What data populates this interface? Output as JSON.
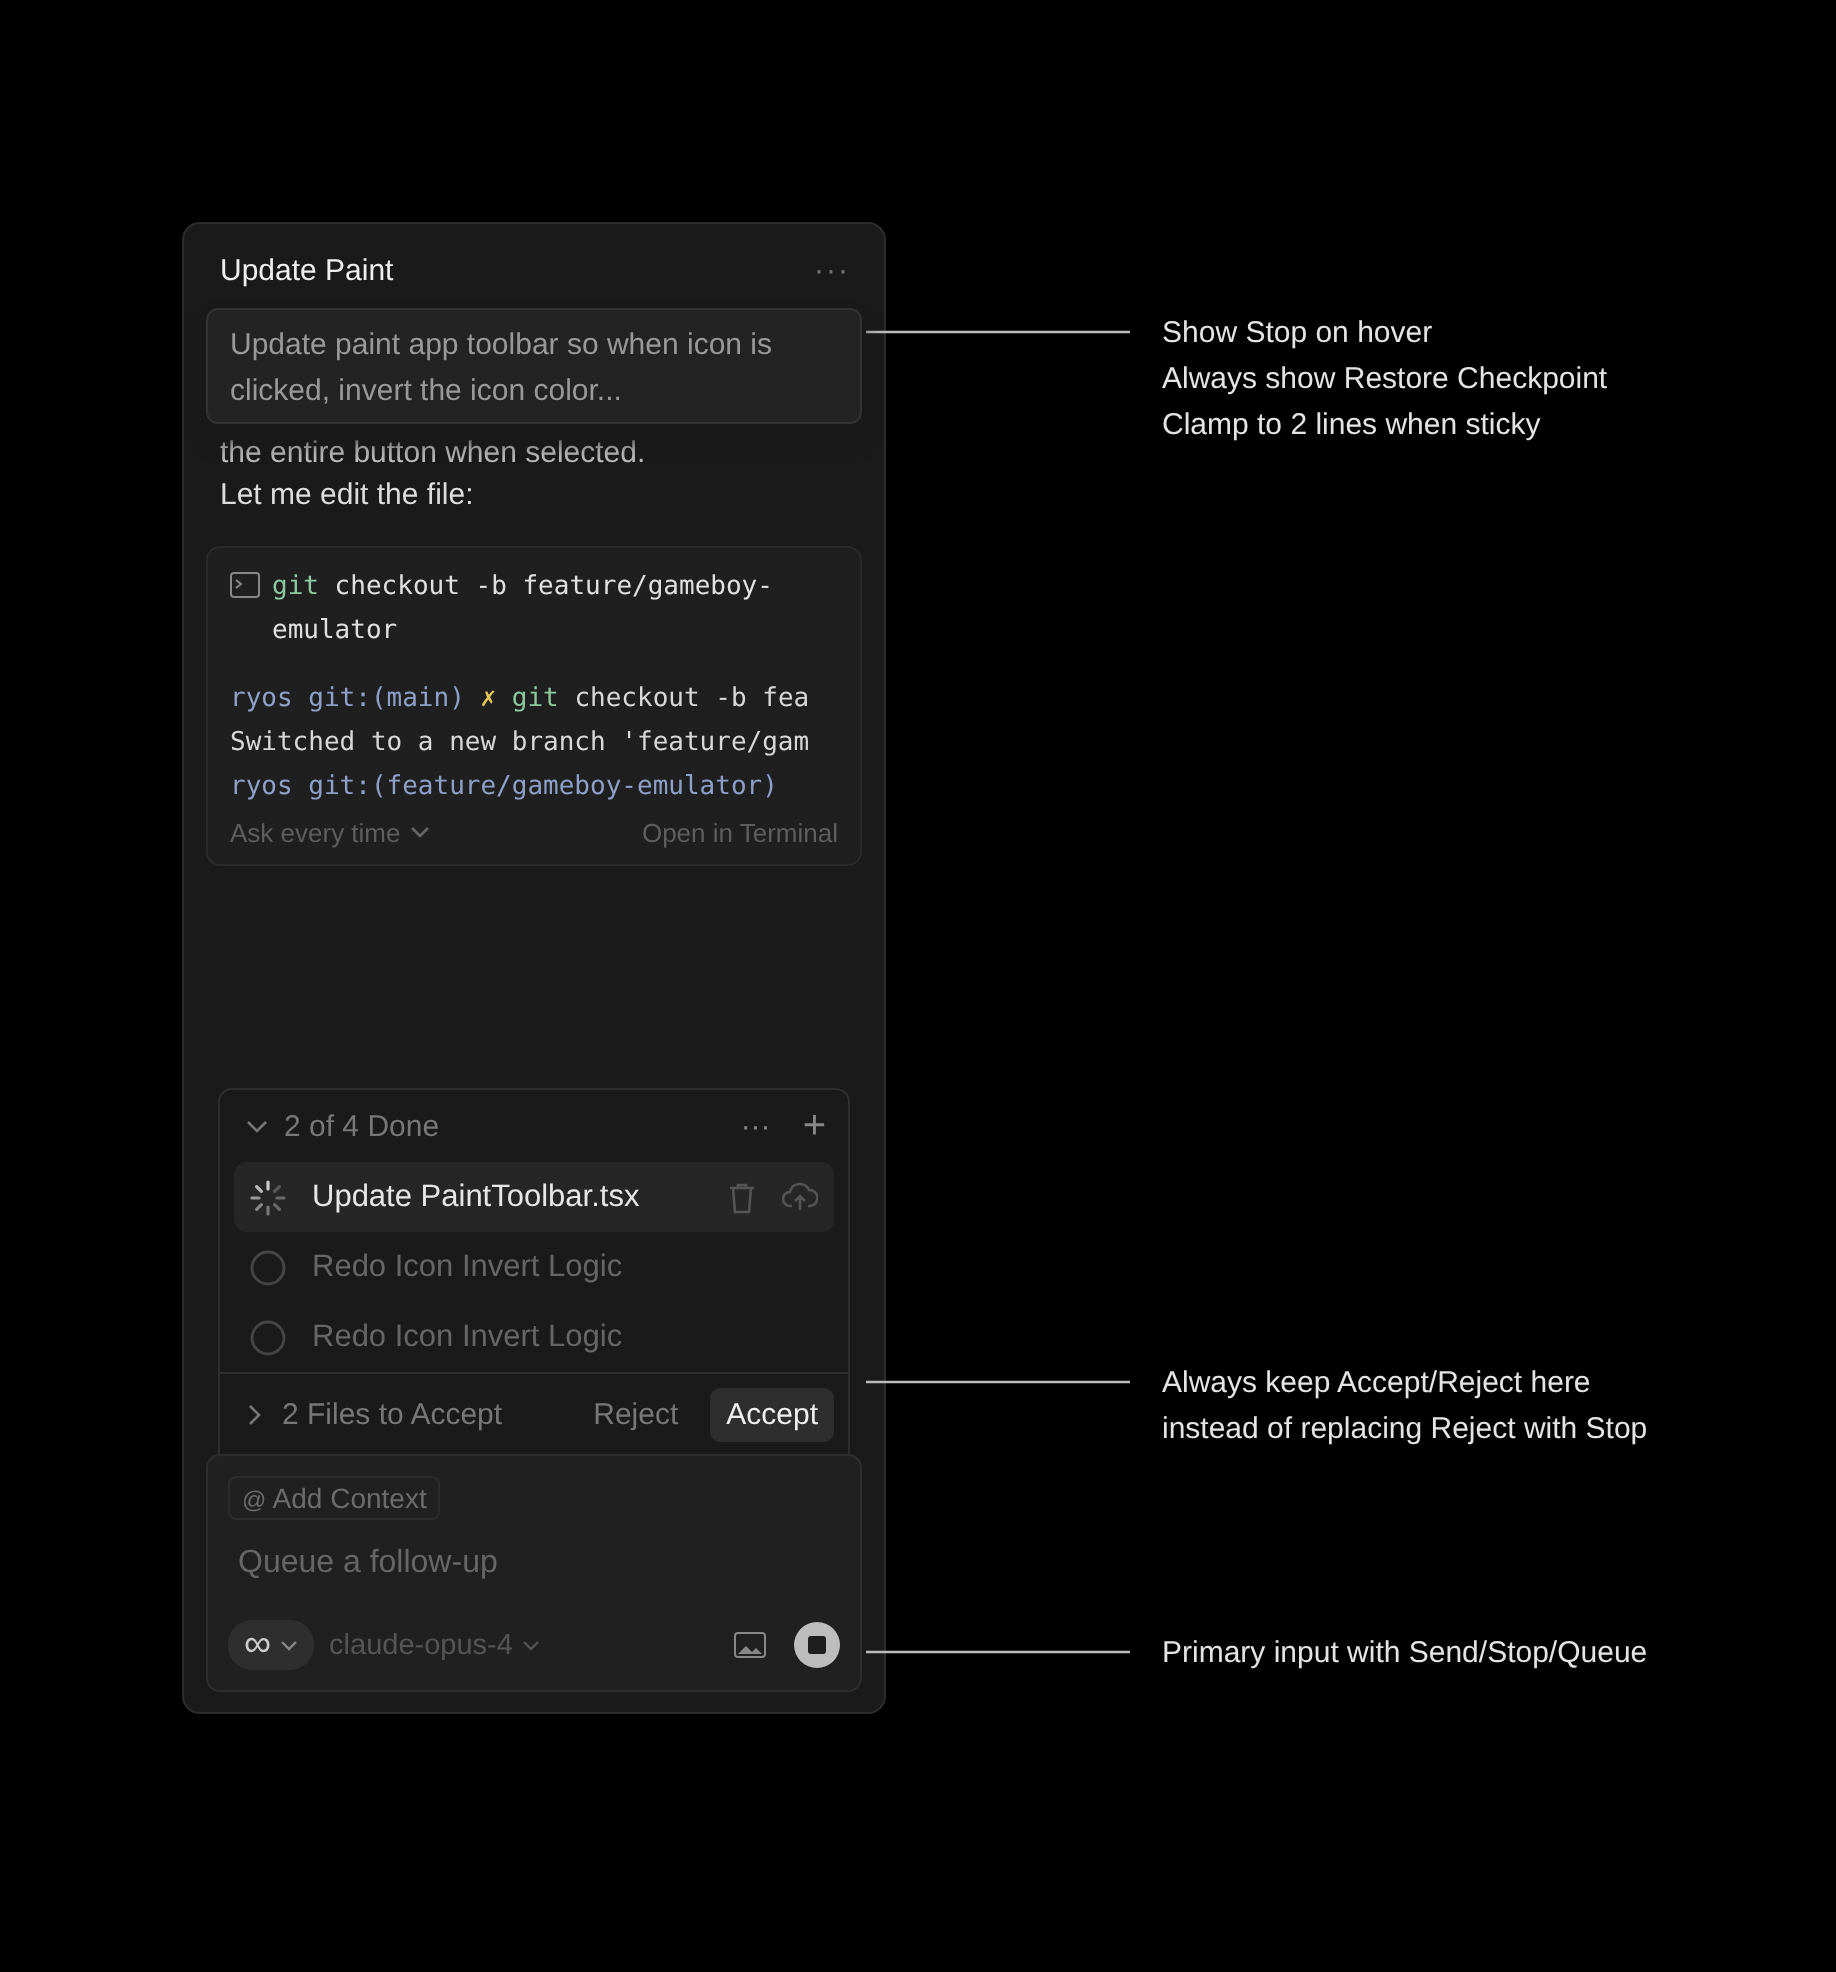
{
  "panel": {
    "title": "Update Paint",
    "menu": "···"
  },
  "sticky_prompt": "Update paint app toolbar so when icon is clicked, invert the icon color...",
  "message": {
    "hidden_line": "the entire button when selected.",
    "line": "Let me edit the file:"
  },
  "terminal": {
    "command_keyword": "git",
    "command": "checkout -b feature/gameboy-emulator",
    "lines": [
      [
        {
          "kind": "prompt",
          "text": "ryos git:(main) "
        },
        {
          "kind": "cross",
          "text": "✗ "
        },
        {
          "kind": "cmd",
          "text": "git "
        },
        {
          "kind": "plain",
          "text": "checkout -b fea"
        }
      ],
      [
        {
          "kind": "plain",
          "text": "Switched to a new branch 'feature/gam"
        }
      ],
      [
        {
          "kind": "prompt",
          "text": "ryos git:(feature/gameboy-emulator)"
        }
      ]
    ],
    "ask": "Ask every time",
    "open": "Open in Terminal"
  },
  "todos": {
    "summary": "2 of 4 Done",
    "expanded": true,
    "more": "···",
    "add": "+",
    "items": [
      {
        "label": "Update PaintToolbar.tsx",
        "kind": "running",
        "selected": true
      },
      {
        "label": "Redo Icon Invert Logic",
        "kind": "pending",
        "selected": false
      },
      {
        "label": "Redo Icon Invert Logic",
        "kind": "pending",
        "selected": false
      }
    ]
  },
  "review": {
    "files": "2 Files to Accept",
    "reject": "Reject",
    "accept": "Accept"
  },
  "composer": {
    "context_at": "@",
    "context": "Add Context",
    "placeholder": "Queue a follow-up",
    "mode": "∞",
    "model": "claude-opus-4"
  },
  "annotations": [
    {
      "lines": [
        "Show Stop on hover",
        "Always show Restore Checkpoint",
        "Clamp to 2 lines when sticky"
      ]
    },
    {
      "lines": [
        "Always keep Accept/Reject here",
        "instead of replacing Reject with Stop"
      ]
    },
    {
      "lines": [
        "Primary input with Send/Stop/Queue"
      ]
    }
  ]
}
